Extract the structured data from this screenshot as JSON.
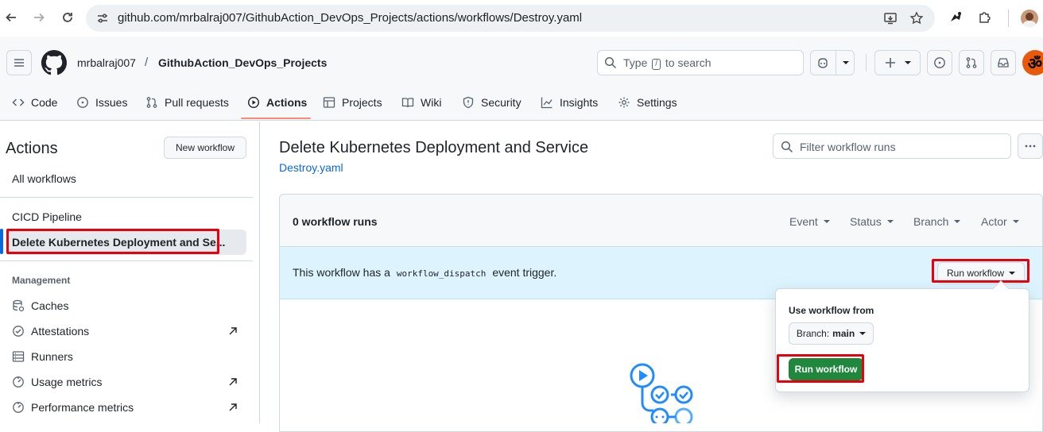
{
  "browser": {
    "url": "github.com/mrbalraj007/GithubAction_DevOps_Projects/actions/workflows/Destroy.yaml"
  },
  "header": {
    "owner": "mrbalraj007",
    "separator": "/",
    "repo": "GithubAction_DevOps_Projects",
    "search_prefix": "Type",
    "search_key": "/",
    "search_suffix": "to search"
  },
  "tabs": [
    {
      "label": "Code",
      "icon": "code-icon"
    },
    {
      "label": "Issues",
      "icon": "issue-icon"
    },
    {
      "label": "Pull requests",
      "icon": "pull-request-icon"
    },
    {
      "label": "Actions",
      "icon": "play-icon",
      "active": true
    },
    {
      "label": "Projects",
      "icon": "table-icon"
    },
    {
      "label": "Wiki",
      "icon": "book-icon"
    },
    {
      "label": "Security",
      "icon": "shield-icon"
    },
    {
      "label": "Insights",
      "icon": "graph-icon"
    },
    {
      "label": "Settings",
      "icon": "gear-icon"
    }
  ],
  "sidebar": {
    "title": "Actions",
    "new_workflow": "New workflow",
    "all_workflows": "All workflows",
    "workflows": [
      {
        "label": "CICD Pipeline"
      },
      {
        "label": "Delete Kubernetes Deployment and Se...",
        "selected": true
      }
    ],
    "management_heading": "Management",
    "management": [
      {
        "label": "Caches",
        "icon": "cache-icon",
        "external": false
      },
      {
        "label": "Attestations",
        "icon": "verified-icon",
        "external": true
      },
      {
        "label": "Runners",
        "icon": "server-icon",
        "external": false
      },
      {
        "label": "Usage metrics",
        "icon": "meter-icon",
        "external": true
      },
      {
        "label": "Performance metrics",
        "icon": "meter-icon",
        "external": true
      }
    ]
  },
  "main": {
    "title": "Delete Kubernetes Deployment and Service",
    "file": "Destroy.yaml",
    "filter_placeholder": "Filter workflow runs",
    "runs_count": "0 workflow runs",
    "filters": [
      "Event",
      "Status",
      "Branch",
      "Actor"
    ],
    "dispatch_prefix": "This workflow has a",
    "dispatch_code": "workflow_dispatch",
    "dispatch_suffix": "event trigger.",
    "run_workflow_button": "Run workflow",
    "popover": {
      "label": "Use workflow from",
      "branch_prefix": "Branch:",
      "branch_value": "main",
      "run_button": "Run workflow"
    }
  },
  "colors": {
    "accent": "#0969da",
    "tab_underline": "#fd8c73",
    "primary_button": "#1f883d",
    "highlight_box": "#e8000b",
    "dispatch_bg": "#ddf4ff"
  }
}
